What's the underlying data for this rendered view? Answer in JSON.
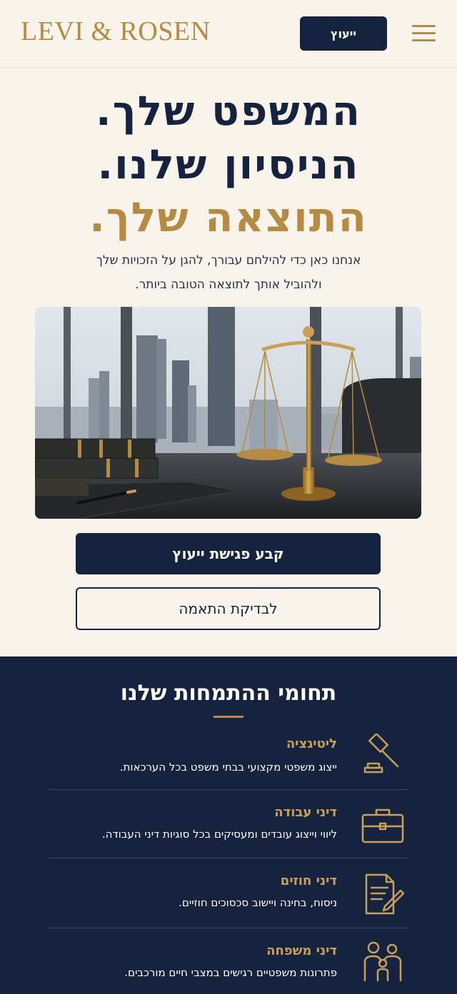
{
  "header": {
    "logo": "LEVI & ROSEN",
    "consult_label": "ייעוץ"
  },
  "hero": {
    "line1": "המשפט שלך.",
    "line2": "הניסיון שלנו.",
    "line3": "התוצאה שלך.",
    "subtitle_line1": "אנחנו כאן כדי להילחם עבורך, להגן על הזכויות שלך",
    "subtitle_line2": "ולהוביל אותך לתוצאה הטובה ביותר.",
    "primary_cta": "קבע פגישת ייעוץ",
    "secondary_cta": "לבדיקת התאמה"
  },
  "practice": {
    "title": "תחומי ההתמחות שלנו",
    "items": [
      {
        "title": "ליטיגציה",
        "desc": "ייצוג משפטי מקצועי בבתי משפט בכל הערכאות.",
        "icon": "gavel-icon"
      },
      {
        "title": "דיני עבודה",
        "desc": "ליווי וייצוג עובדים ומעסיקים בכל סוגיות דיני העבודה.",
        "icon": "briefcase-icon"
      },
      {
        "title": "דיני חוזים",
        "desc": "ניסוח, בחינה ויישוב סכסוכים חוזיים.",
        "icon": "contract-icon"
      },
      {
        "title": "דיני משפחה",
        "desc": "פתרונות משפטיים רגישים במצבי חיים מורכבים.",
        "icon": "family-icon"
      }
    ]
  },
  "colors": {
    "navy": "#16233f",
    "gold": "#b58a42",
    "cream": "#f8f4ec"
  }
}
